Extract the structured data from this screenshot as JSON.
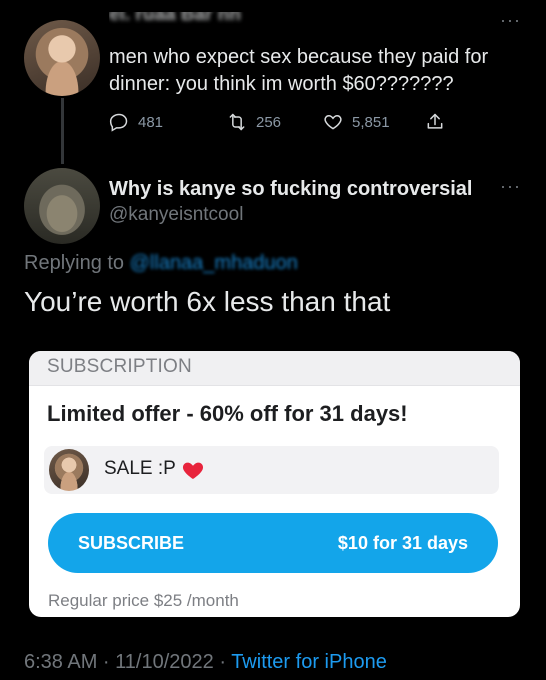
{
  "parent_tweet": {
    "author_name_obscured": "el. ruaa Bar nh",
    "text": "men who expect sex because they paid for dinner: you think im worth $60???????",
    "replies": "481",
    "retweets": "256",
    "likes": "5,851",
    "more_icon": "more-dots-icon"
  },
  "reply_tweet": {
    "author_name": "Why is kanye so fucking controversial",
    "handle": "@kanyeisntcool",
    "replying_prefix": "Replying to",
    "replying_to": "@llanaa_mhaduon",
    "text": "You’re worth 6x less than that",
    "timestamp": "6:38 AM · 11/10/2022 ·",
    "source": "Twitter for iPhone"
  },
  "subscription_card": {
    "header": "SUBSCRIPTION",
    "offer_title": "Limited offer - 60% off for 31 days!",
    "sale_label": "SALE :P",
    "button_label": "SUBSCRIBE",
    "button_price": "$10 for 31 days",
    "regular_price": "Regular price $25 /month"
  },
  "colors": {
    "background": "#000000",
    "link": "#1d9bf0",
    "muted": "#71767b",
    "subscribe_button": "#13a5ea",
    "heart": "#e8243c"
  }
}
